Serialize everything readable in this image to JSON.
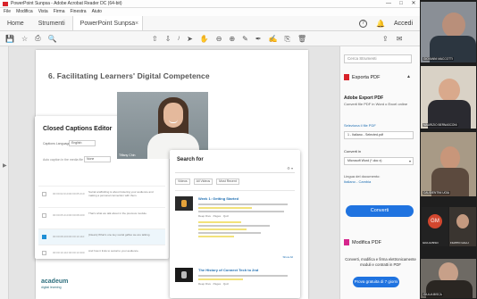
{
  "window": {
    "title": "PowerPoint Sunpsa - Adobe Acrobat Reader DC (64-bit)",
    "controls": [
      "—",
      "□",
      "✕"
    ]
  },
  "menu": [
    "File",
    "Modifica",
    "Vista",
    "Firma",
    "Finestra",
    "Aiuto"
  ],
  "tabs": {
    "home": "Home",
    "strumenti": "Strumenti",
    "document": "PowerPoint Sunpsa",
    "accedi": "Accedi"
  },
  "toolbar": {
    "page_sep": "/",
    "icons": [
      "save-icon",
      "star-icon",
      "print-icon",
      "search-icon",
      "upload-icon",
      "download-icon",
      "page-number",
      "cursor-icon",
      "hand-icon",
      "zoom-out-icon",
      "zoom-in-icon",
      "comment-icon",
      "pen-icon",
      "sign-icon",
      "attach-icon",
      "delete-icon",
      "share-icon",
      "mail-icon"
    ]
  },
  "slide": {
    "title": "6.  Facilitating Learners' Digital Competence",
    "logo": "acadeum",
    "logo_sub": "digital learning"
  },
  "captions_editor": {
    "title": "Closed Captions Editor",
    "language_label": "Captions Language",
    "language_value": "English",
    "hint_label": "Auto caption in the media file",
    "hint_value": "None",
    "rows": [
      {
        "t1": "00:00:02.010",
        "t2": "00:00:05.210",
        "text": "Social scaffolding is about fostering your audience and making a personal connection with them."
      },
      {
        "t1": "00:00:05.210",
        "t2": "00:00:08.200",
        "text": "That's what we talk about in the previous module."
      },
      {
        "t1": "00:00:08.200",
        "t2": "00:00:10.110",
        "text": "[Clears] What's one key social gaffes we are talking."
      },
      {
        "t1": "00:00:10.110",
        "t2": "00:00:13.300",
        "text": "And how it links to social to your audience."
      }
    ]
  },
  "presenter": {
    "name": "Tiffany Chin"
  },
  "search_panel": {
    "title": "Search for",
    "filters": [
      "Videos",
      "All Videos",
      "Most Recent"
    ],
    "results": [
      {
        "title": "Week 1: Getting Started",
        "meta": "Deep Dive  ·  Pages  ·  Quiz"
      },
      {
        "title": "The History of Connect Tech to 2nd",
        "meta": "Deep Dive  ·  Pages  ·  Quiz"
      }
    ],
    "more": "Show All"
  },
  "tool_pane": {
    "search_tools": "Cerca Strumenti",
    "export_pdf": "Esporta PDF",
    "aeb_title": "Adobe Export PDF",
    "aeb_desc": "Converti file PDF in Word o Excel online",
    "select_label": "Seleziona il file PDF",
    "file_name": "1 - Italiano - Selected.pdf",
    "convert_label": "Converti in",
    "convert_value": "Microsoft Word (*.doc x)",
    "lang_label": "Lingua del documento:",
    "lang_value": "Italiano - Cambia",
    "convert_button": "Converti",
    "modify_pdf": "Modifica PDF",
    "promo": "Converti, modifica e firma elettronicamente moduli e contratti in PDF",
    "trial_button": "Prova gratuita di 7 giorni"
  },
  "gallery": {
    "participants": [
      "GIOVANNI MACCOTTI",
      "MAURIZIO BERNASCONI",
      "CAUDIENTINI UGIA",
      "GIULIA BISO",
      "FILIPPO GALLI",
      "GIULIA BISCA"
    ],
    "gm_initials": "GM"
  },
  "colors": {
    "accent": "#1f73e0",
    "acrobat_red": "#d8232a",
    "highlight": "#f2e27a"
  }
}
